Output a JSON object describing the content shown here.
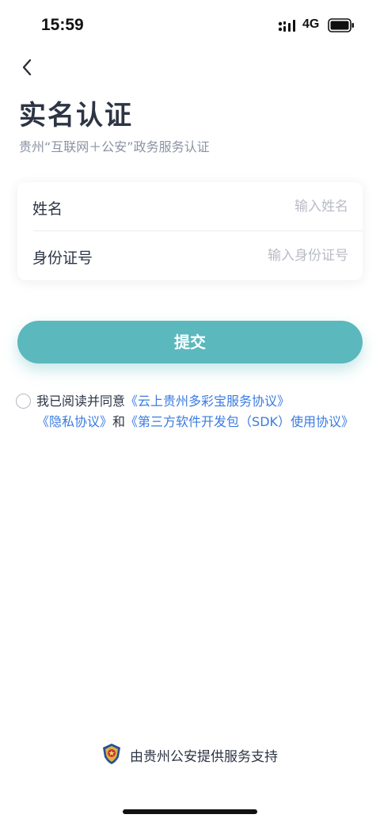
{
  "status_bar": {
    "time": "15:59",
    "network": "4G"
  },
  "header": {
    "title": "实名认证",
    "subtitle": "贵州“互联网＋公安”政务服务认证"
  },
  "form": {
    "name_label": "姓名",
    "name_placeholder": "输入姓名",
    "name_value": "",
    "id_label": "身份证号",
    "id_placeholder": "输入身份证号",
    "id_value": ""
  },
  "submit_label": "提交",
  "agreement": {
    "checked": false,
    "prefix": "我已阅读并同意",
    "link1": "《云上贵州多彩宝服务协议》",
    "link2": "《隐私协议》",
    "conjunction": "和",
    "link3": "《第三方软件开发包（SDK）使用协议》"
  },
  "footer": {
    "text": "由贵州公安提供服务支持"
  },
  "colors": {
    "accent": "#5bb8bd",
    "link": "#3a7be0",
    "title": "#2d3444",
    "subtitle": "#8a93a3"
  },
  "icons": [
    "back-icon",
    "signal-icon",
    "battery-icon",
    "police-badge-icon"
  ]
}
